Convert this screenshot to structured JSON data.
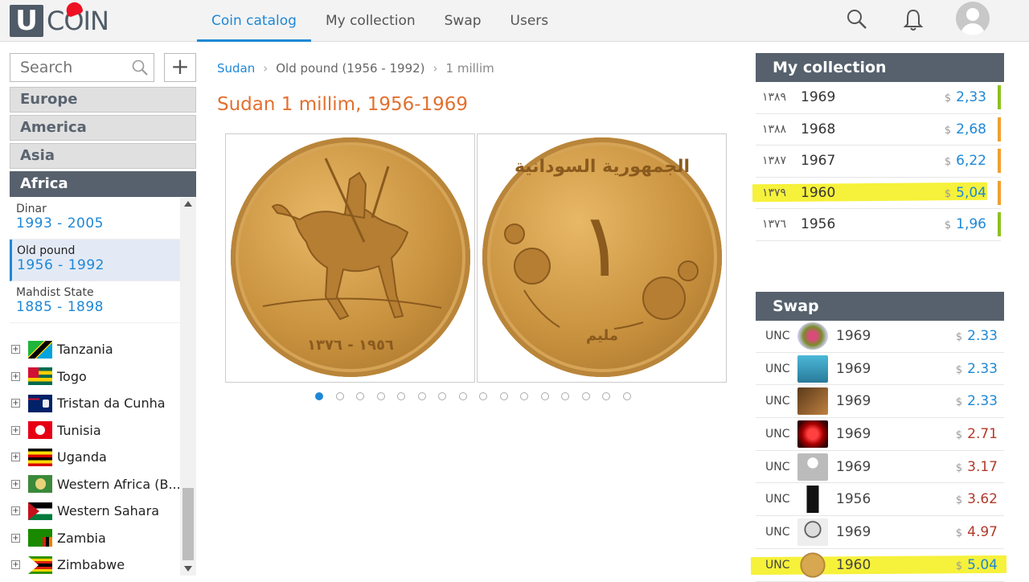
{
  "app": {
    "logo_letter": "U",
    "logo_text": "COIN"
  },
  "nav": {
    "tabs": [
      {
        "label": "Coin catalog"
      },
      {
        "label": "My collection"
      },
      {
        "label": "Swap"
      },
      {
        "label": "Users"
      }
    ]
  },
  "header_icons": [
    "search-icon",
    "bell-icon",
    "avatar"
  ],
  "sidebar": {
    "search_placeholder": "Search",
    "add_label": "+",
    "regions": [
      {
        "label": "Europe"
      },
      {
        "label": "America"
      },
      {
        "label": "Asia"
      },
      {
        "label": "Africa"
      }
    ],
    "periods": [
      {
        "name": "Dinar",
        "years": "1993 - 2005"
      },
      {
        "name": "Old pound",
        "years": "1956 - 1992"
      },
      {
        "name": "Mahdist State",
        "years": "1885 - 1898"
      }
    ],
    "countries": [
      {
        "name": "Tanzania"
      },
      {
        "name": "Togo"
      },
      {
        "name": "Tristan da Cunha"
      },
      {
        "name": "Tunisia"
      },
      {
        "name": "Uganda"
      },
      {
        "name": "Western Africa (B..."
      },
      {
        "name": "Western Sahara"
      },
      {
        "name": "Zambia"
      },
      {
        "name": "Zimbabwe"
      }
    ]
  },
  "breadcrumb": {
    "country": "Sudan",
    "period": "Old pound (1956 - 1992)",
    "current": "1 millim"
  },
  "coin": {
    "title": "Sudan 1 millim, 1956-1969",
    "obverse_legend": "١٩٥٦ - ١٣٧٦",
    "reverse_value": "١",
    "reverse_legend": "الجمهورية السودانية",
    "reverse_unit": "مليم",
    "gallery_count": 16,
    "gallery_active": 1
  },
  "my_collection": {
    "title": "My collection",
    "currency": "$",
    "rows": [
      {
        "arabic_year": "١٣٨٩",
        "year": "1969",
        "price": "2,33",
        "bar_color": "#8dc21f"
      },
      {
        "arabic_year": "١٣٨٨",
        "year": "1968",
        "price": "2,68",
        "bar_color": "#f0a030"
      },
      {
        "arabic_year": "١٣٨٧",
        "year": "1967",
        "price": "6,22",
        "bar_color": "#f0a030"
      },
      {
        "arabic_year": "١٣٧٩",
        "year": "1960",
        "price": "5,04",
        "bar_color": "#f0a030"
      },
      {
        "arabic_year": "١٣٧٦",
        "year": "1956",
        "price": "1,96",
        "bar_color": "#8dc21f"
      }
    ]
  },
  "swap": {
    "title": "Swap",
    "currency": "$",
    "rows": [
      {
        "condition": "UNC",
        "year": "1969",
        "price": "2.33",
        "price_color": "blue"
      },
      {
        "condition": "UNC",
        "year": "1969",
        "price": "2.33",
        "price_color": "blue"
      },
      {
        "condition": "UNC",
        "year": "1969",
        "price": "2.33",
        "price_color": "blue"
      },
      {
        "condition": "UNC",
        "year": "1969",
        "price": "2.71",
        "price_color": "red"
      },
      {
        "condition": "UNC",
        "year": "1969",
        "price": "3.17",
        "price_color": "red"
      },
      {
        "condition": "UNC",
        "year": "1956",
        "price": "3.62",
        "price_color": "red"
      },
      {
        "condition": "UNC",
        "year": "1969",
        "price": "4.97",
        "price_color": "red"
      },
      {
        "condition": "UNC",
        "year": "1960",
        "price": "5.04",
        "price_color": "blue"
      }
    ]
  },
  "colors": {
    "accent": "#1e88d6",
    "title": "#e2702f",
    "panel_header": "#56616d",
    "highlight": "#f5ef18"
  }
}
